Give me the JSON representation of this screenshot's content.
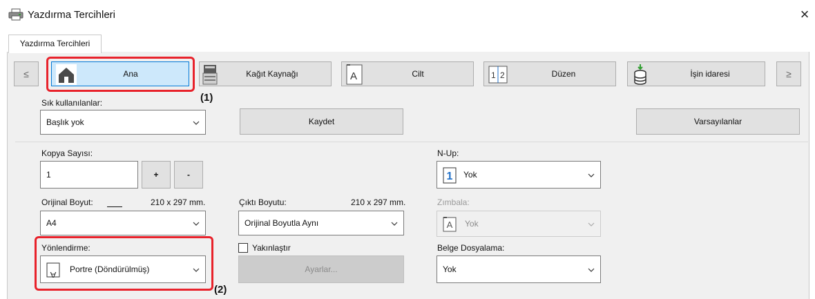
{
  "window": {
    "title": "Yazdırma Tercihleri",
    "close_glyph": "×"
  },
  "tab": {
    "label": "Yazdırma Tercihleri"
  },
  "nav": {
    "prev_glyph": "≤",
    "next_glyph": "≥",
    "items": [
      {
        "label": "Ana",
        "icon": "home-icon",
        "active": true
      },
      {
        "label": "Kağıt Kaynağı",
        "icon": "printer-icon",
        "active": false
      },
      {
        "label": "Cilt",
        "icon": "binding-icon",
        "active": false
      },
      {
        "label": "Düzen",
        "icon": "layout-icon",
        "active": false
      },
      {
        "label": "İşin idaresi",
        "icon": "job-handling-icon",
        "active": false
      }
    ]
  },
  "favorites": {
    "label": "Sık kullanılanlar:",
    "value": "Başlık yok",
    "save_label": "Kaydet",
    "defaults_label": "Varsayılanlar"
  },
  "copies": {
    "label": "Kopya Sayısı:",
    "value": "1",
    "plus": "+",
    "minus": "-"
  },
  "original_size": {
    "label": "Orijinal Boyut:",
    "dims": "210 x 297 mm.",
    "value": "A4"
  },
  "output_size": {
    "label": "Çıktı Boyutu:",
    "dims": "210 x 297 mm.",
    "value": "Orijinal Boyutla Aynı"
  },
  "zoom": {
    "label": "Yakınlaştır",
    "settings_label": "Ayarlar...",
    "checked": false
  },
  "orientation": {
    "label": "Yönlendirme:",
    "value": "Portre (Döndürülmüş)",
    "icon_glyph": "A"
  },
  "nup": {
    "label": "N-Up:",
    "value": "Yok",
    "icon_glyph": "1"
  },
  "staple": {
    "label": "Zımbala:",
    "value": "Yok",
    "icon_glyph": "A"
  },
  "doc_filing": {
    "label": "Belge Dosyalama:",
    "value": "Yok"
  },
  "callouts": {
    "one": "(1)",
    "two": "(2)"
  },
  "colors": {
    "highlight": "#e8222b",
    "active_tab": "#cde8fb",
    "accent": "#0078d7",
    "nup_blue": "#1e6fc8"
  }
}
